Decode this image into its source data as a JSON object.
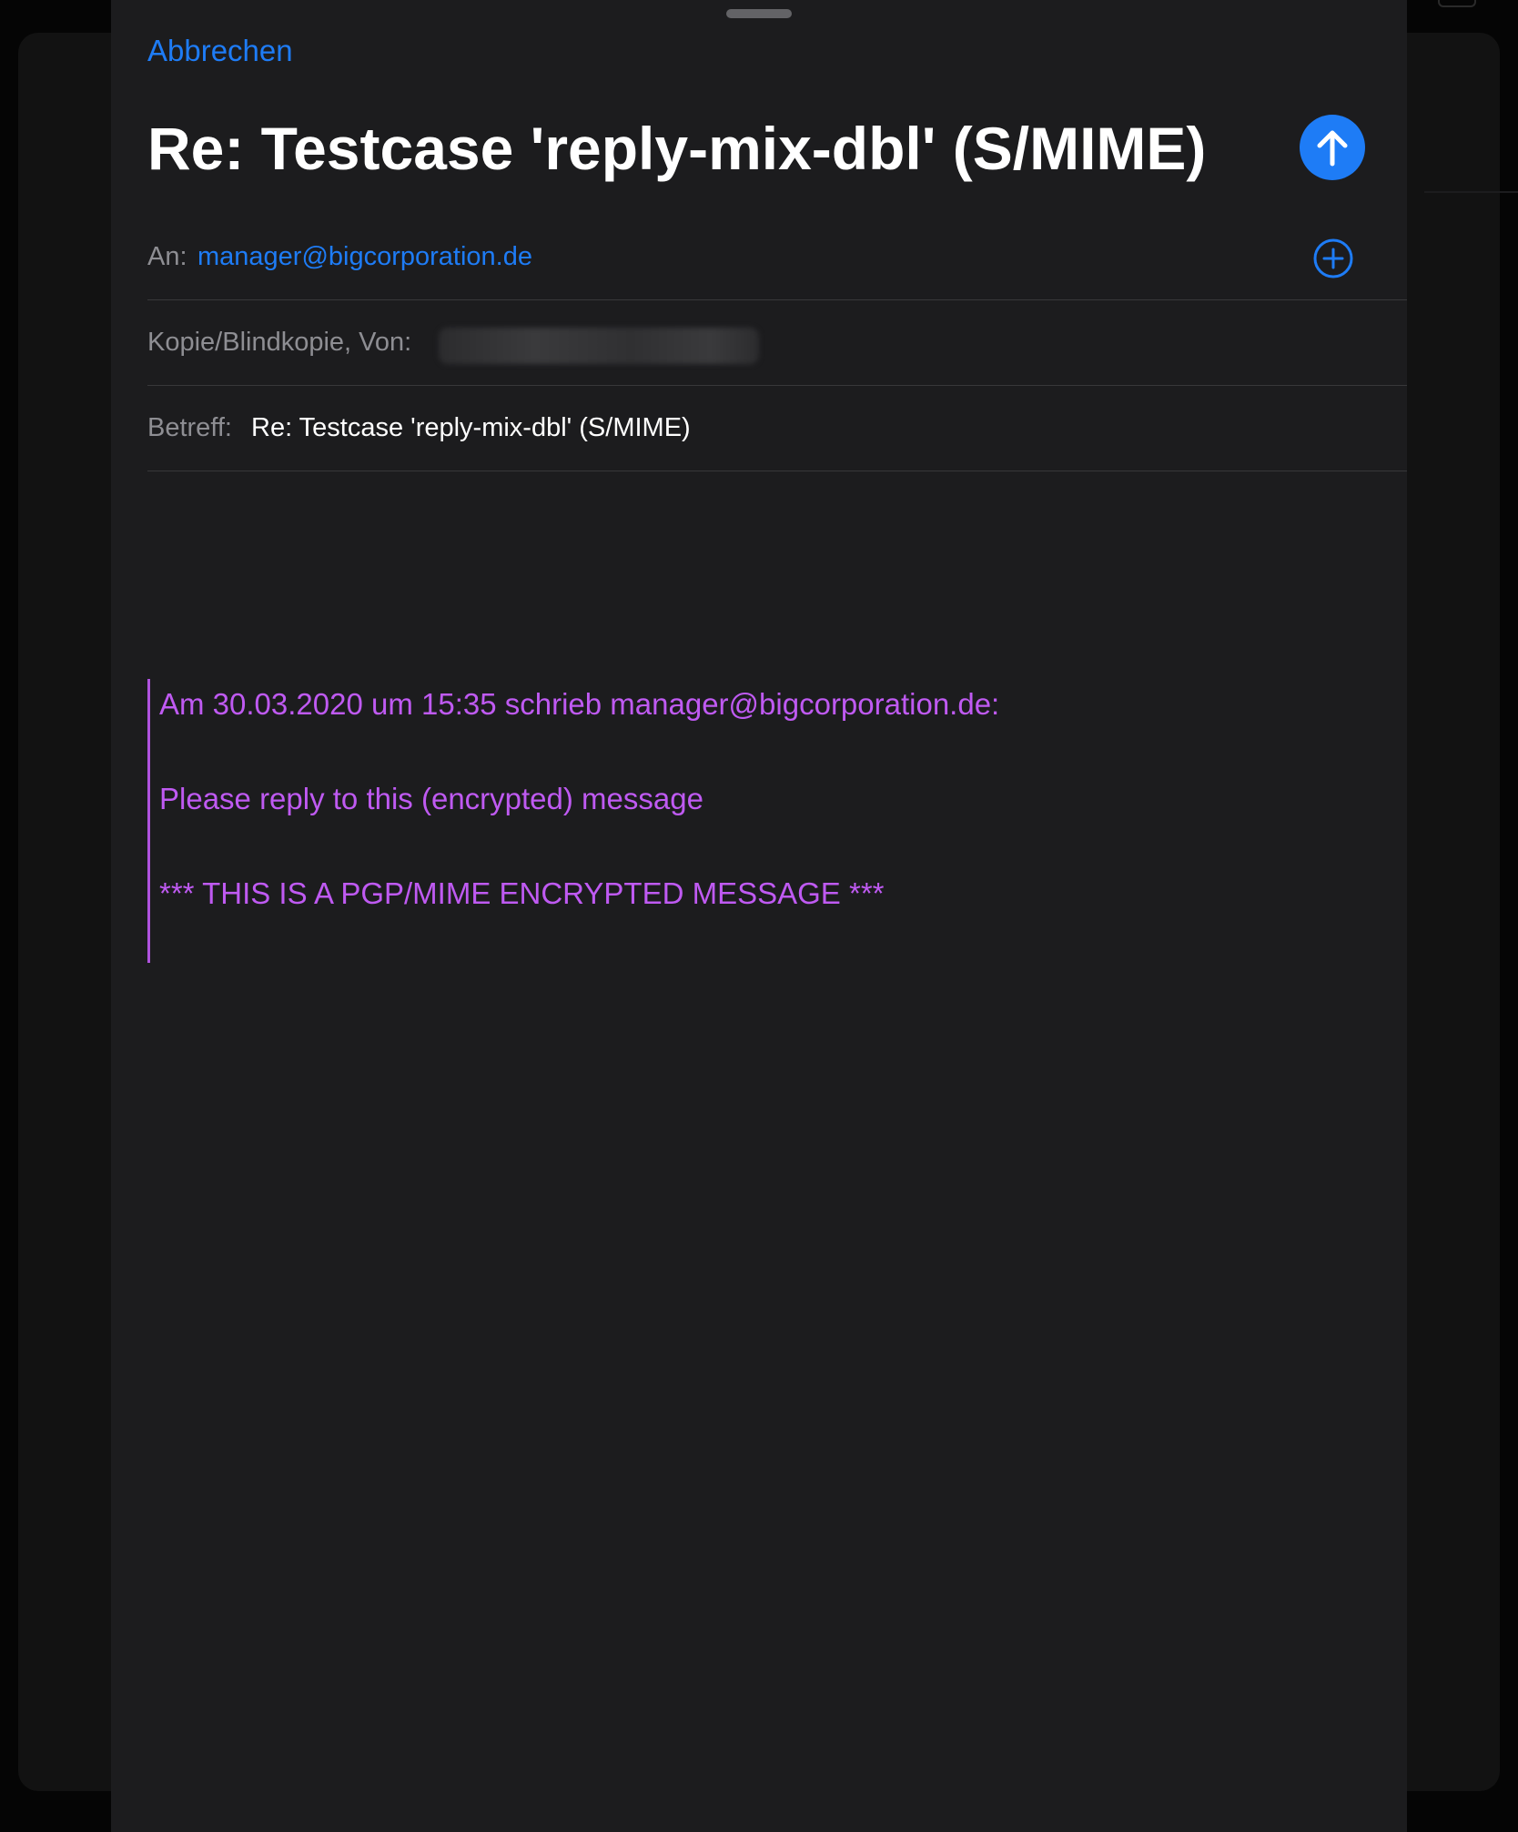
{
  "compose": {
    "cancel_label": "Abbrechen",
    "title": "Re: Testcase 'reply-mix-dbl' (S/MIME)",
    "send_icon": "arrow-up-icon"
  },
  "fields": {
    "to_label": "An:",
    "to_value": "manager@bigcorporation.de",
    "add_icon": "plus-circle-icon",
    "cc_label": "Kopie/Blindkopie, Von:",
    "subject_label": "Betreff:",
    "subject_value": "Re: Testcase 'reply-mix-dbl' (S/MIME)"
  },
  "quote": {
    "header": "Am 30.03.2020 um 15:35 schrieb manager@bigcorporation.de:",
    "line1": "Please reply to this (encrypted) message",
    "line2": "*** THIS IS A PGP/MIME ENCRYPTED MESSAGE ***"
  },
  "colors": {
    "accent": "#1e7cf6",
    "quote": "#bf5af2",
    "sheet_background": "#1c1c1e"
  }
}
